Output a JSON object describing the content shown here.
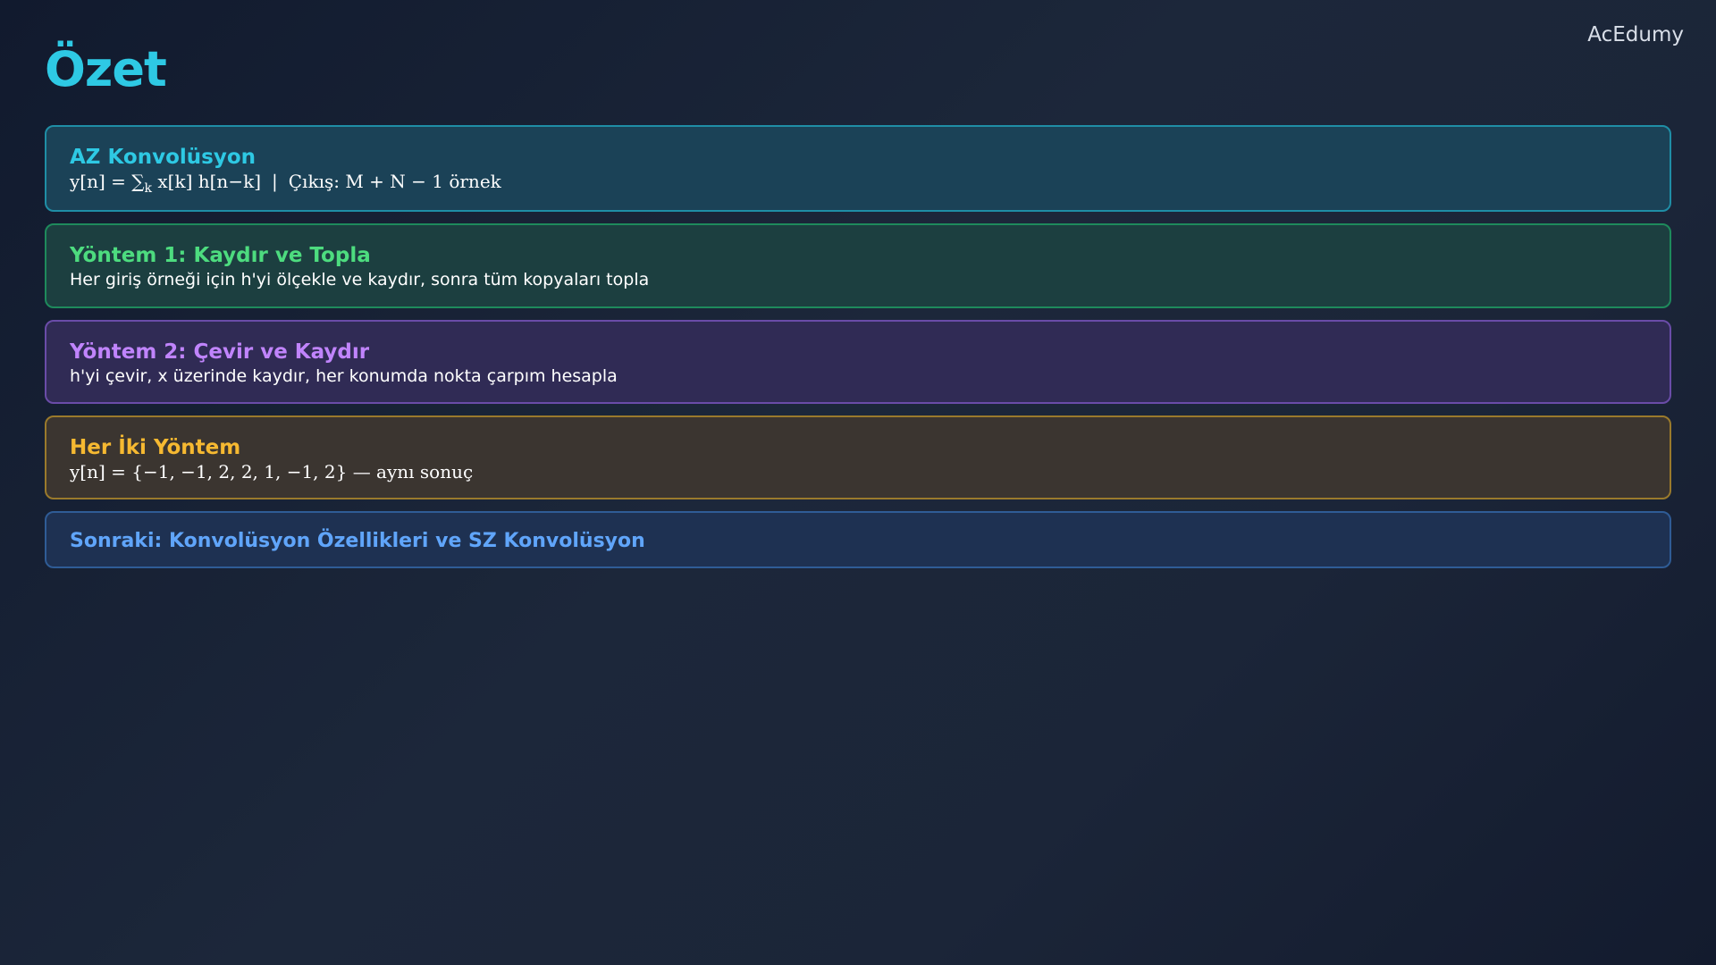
{
  "header": {
    "title": "Özet",
    "brand": "AcEdumy"
  },
  "cards": [
    {
      "title": "AZ Konvolüsyon",
      "formula_lhs": "y[n] = ∑",
      "formula_sub": "k",
      "formula_rhs": " x[k] h[n−k]",
      "separator": "|",
      "output_text": "Çıkış: M + N − 1 örnek"
    },
    {
      "title": "Yöntem 1: Kaydır ve Topla",
      "body": "Her giriş örneği için h'yi ölçekle ve kaydır, sonra tüm kopyaları topla"
    },
    {
      "title": "Yöntem 2: Çevir ve Kaydır",
      "body": "h'yi çevir, x üzerinde kaydır, her konumda nokta çarpım hesapla"
    },
    {
      "title": "Her İki Yöntem",
      "body": "y[n] = {−1, −1, 2, 2, 1, −1, 2}  —  aynı sonuç"
    },
    {
      "title": "Sonraki: Konvolüsyon Özellikleri ve SZ Konvolüsyon"
    }
  ],
  "colors": {
    "accent_cyan": "#2ec9e4",
    "accent_green": "#4ddc7f",
    "accent_purple": "#c084fc",
    "accent_amber": "#f6b931",
    "accent_blue": "#60a5fa"
  }
}
